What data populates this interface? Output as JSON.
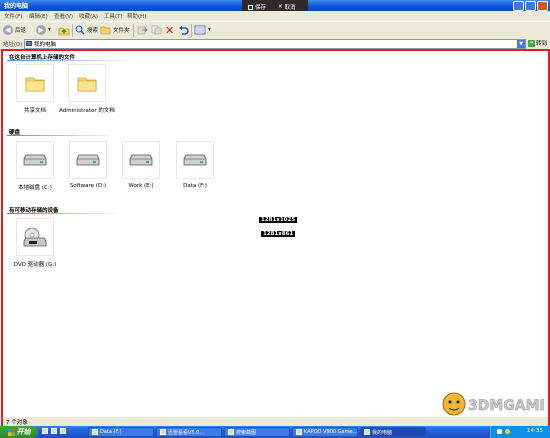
{
  "window": {
    "title": "我的电脑"
  },
  "overlay": {
    "save": "保存",
    "cancel": "取消"
  },
  "menu": [
    "文件(F)",
    "编辑(E)",
    "查看(V)",
    "收藏(A)",
    "工具(T)",
    "帮助(H)"
  ],
  "toolbar": {
    "back": "后退",
    "search": "搜索",
    "folders": "文件夹"
  },
  "address": {
    "label": "地址(D)",
    "value": "我的电脑",
    "go": "转到"
  },
  "sections": {
    "stored": "在这台计算机上存储的文件",
    "drives": "硬盘",
    "removable": "有可移动存储的设备"
  },
  "folders": [
    "共享文档",
    "Administrator 的文档"
  ],
  "drives": [
    "本地磁盘 (C:)",
    "Software (D:)",
    "Work (E:)",
    "Data (F:)"
  ],
  "removable": [
    "DVD 驱动器 (G:)"
  ],
  "resolution_labels": [
    "1281x1025",
    "1281x861"
  ],
  "status": {
    "text": "7 个对象"
  },
  "taskbar": {
    "start": "开始",
    "items": [
      "Data (F:)",
      "迅雷看看V5.0...",
      "搜索截图",
      "KAPOO V900 Game...",
      "我的电脑"
    ],
    "clock": "14:35"
  },
  "watermark": {
    "brand": "3DMGAME"
  }
}
